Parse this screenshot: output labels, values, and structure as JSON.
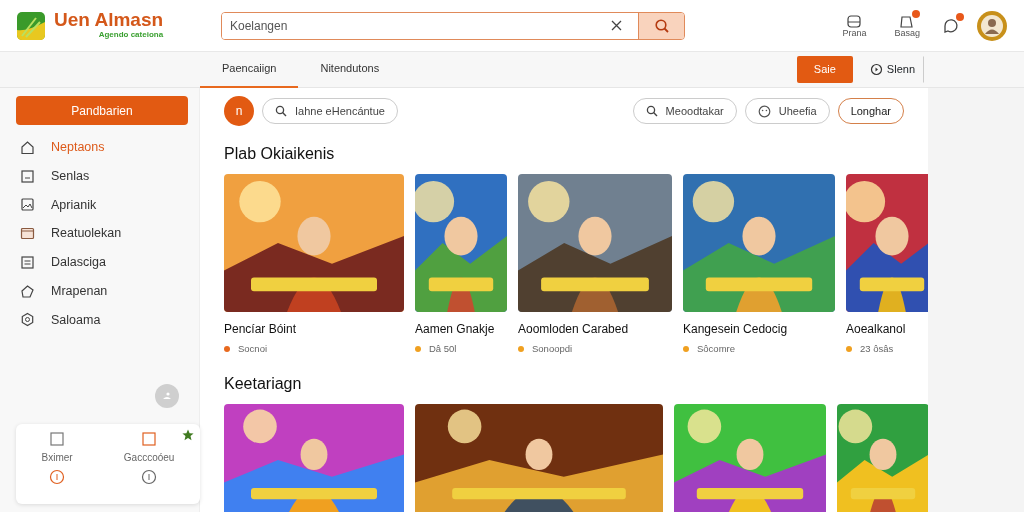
{
  "header": {
    "logo_title": "Uen Almasn",
    "logo_subtitle": "Agendo cateiona",
    "search": {
      "value": "Koelangen"
    },
    "actions": [
      {
        "label": "Prana",
        "badge": false
      },
      {
        "label": "Basag",
        "badge": true
      }
    ],
    "notify_badge": true
  },
  "subnav": {
    "tabs": [
      {
        "label": "Paencaiign",
        "selected": true
      },
      {
        "label": "Nitendutons",
        "selected": false
      }
    ],
    "primary_button": "Saie",
    "secondary_button": "Slenn"
  },
  "sidebar": {
    "cta": "Pandbarien",
    "items": [
      {
        "label": "Neptaons",
        "selected": true
      },
      {
        "label": "Senlas",
        "selected": false
      },
      {
        "label": "Aprianik",
        "selected": false
      },
      {
        "label": "Reatuolekan",
        "selected": false
      },
      {
        "label": "Dalasciga",
        "selected": false
      },
      {
        "label": "Mrapenan",
        "selected": false
      },
      {
        "label": "Saloama",
        "selected": false
      }
    ],
    "panel": [
      {
        "label": "Bximer",
        "starred": false
      },
      {
        "label": "Gacccoóeu",
        "starred": true
      }
    ]
  },
  "filters": {
    "avatar_letter": "n",
    "chips": [
      {
        "label": "Iahne eHencántue",
        "kind": "chip"
      },
      {
        "label": "Meoodtakar",
        "kind": "chip"
      },
      {
        "label": "Uheefia",
        "kind": "chip"
      },
      {
        "label": "Longhar",
        "kind": "outline"
      }
    ]
  },
  "sections": [
    {
      "title": "Plab Okiaikenis",
      "cards": [
        {
          "title": "Pencíar Bóint",
          "meta": "Socnoi",
          "color": "#e8691e"
        },
        {
          "title": "Aamen Gnakje",
          "meta": "Dâ 50l",
          "color": "#f0a020"
        },
        {
          "title": "Aoomloden Carabed",
          "meta": "Sonoopdi",
          "color": "#f0a020"
        },
        {
          "title": "Kangesein Cedocig",
          "meta": "Sôcomre",
          "color": "#f0a020"
        },
        {
          "title": "Aoealkanol",
          "meta": "23 ôsâs",
          "color": "#f0a020"
        }
      ]
    },
    {
      "title": "Keetariagn"
    }
  ]
}
